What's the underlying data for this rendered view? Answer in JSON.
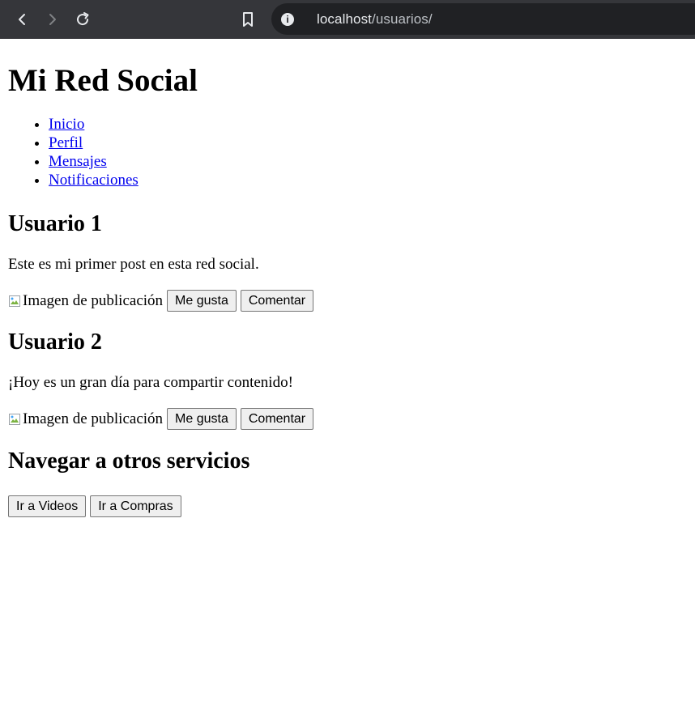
{
  "browser": {
    "url_host": "localhost",
    "url_path": "/usuarios/"
  },
  "site": {
    "title": "Mi Red Social"
  },
  "nav": {
    "items": [
      {
        "label": "Inicio"
      },
      {
        "label": "Perfil"
      },
      {
        "label": "Mensajes"
      },
      {
        "label": "Notificaciones"
      }
    ]
  },
  "posts": [
    {
      "user": "Usuario 1",
      "text": "Este es mi primer post en esta red social.",
      "image_alt": "Imagen de publicación",
      "like_label": "Me gusta",
      "comment_label": "Comentar"
    },
    {
      "user": "Usuario 2",
      "text": "¡Hoy es un gran día para compartir contenido!",
      "image_alt": "Imagen de publicación",
      "like_label": "Me gusta",
      "comment_label": "Comentar"
    }
  ],
  "services": {
    "heading": "Navegar a otros servicios",
    "videos_label": "Ir a Videos",
    "shopping_label": "Ir a Compras"
  }
}
